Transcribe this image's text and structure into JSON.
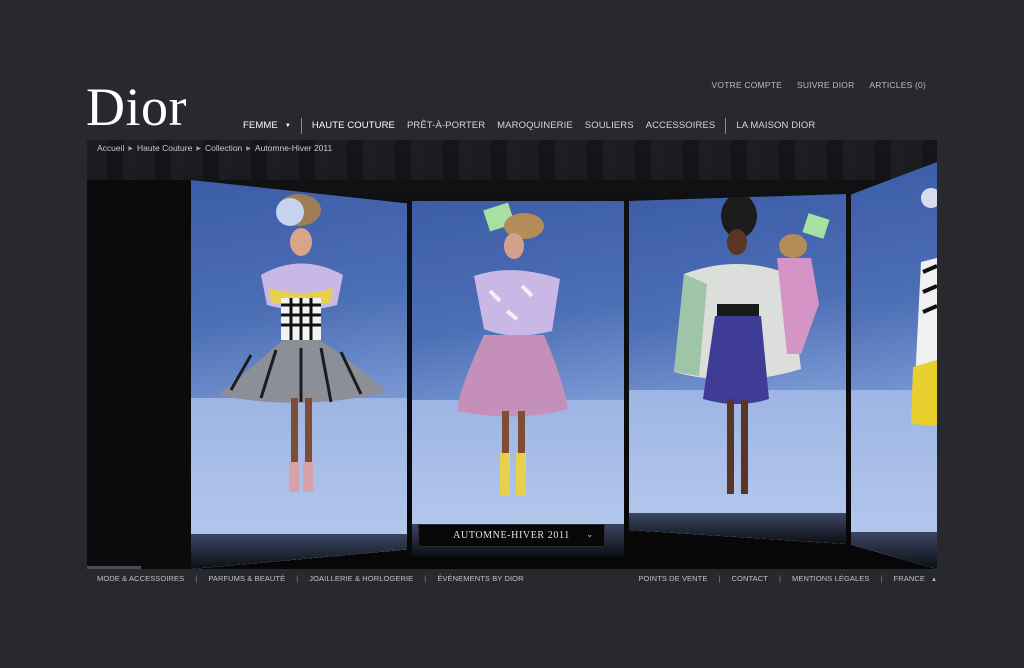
{
  "brand": {
    "logo": "Dior"
  },
  "top_links": [
    "VOTRE COMPTE",
    "SUIVRE DIOR",
    "ARTICLES (0)"
  ],
  "main_nav": {
    "femme": "FEMME",
    "items": [
      "HAUTE COUTURE",
      "PRÊT-À-PORTER",
      "MAROQUINERIE",
      "SOULIERS",
      "ACCESSOIRES"
    ],
    "maison": "LA MAISON DIOR"
  },
  "breadcrumb": [
    "Accueil",
    "Haute Couture",
    "Collection",
    "Automne-Hiver 2011"
  ],
  "collection_select": {
    "value": "AUTOMNE-HIVER 2011"
  },
  "footer": {
    "left": [
      "MODE & ACCESSOIRES",
      "PARFUMS & BEAUTÉ",
      "JOAILLERIE & HORLOGERIE",
      "ÉVÉNEMENTS BY DIOR"
    ],
    "right": [
      "POINTS DE VENTE",
      "CONTACT",
      "MENTIONS LÉGALES"
    ],
    "country": "FRANCE"
  },
  "colors": {
    "background": "#27292e",
    "text": "#cfd0d3",
    "stage": "#0b0b0c",
    "runway_blue": "#6f8fd0"
  },
  "icons": [
    "dropdown-caret-icon",
    "breadcrumb-arrow-icon",
    "chevron-down-icon",
    "chevron-up-icon"
  ]
}
